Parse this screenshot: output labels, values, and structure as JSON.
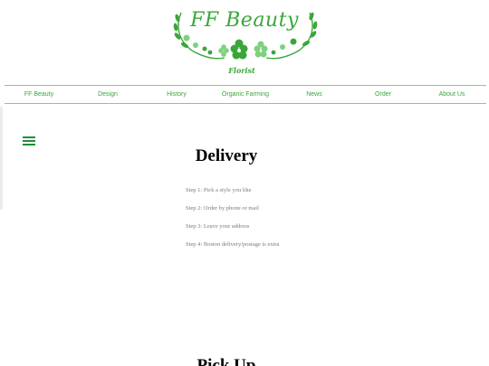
{
  "logo": {
    "title": "FF Beauty",
    "subtitle": "Florist"
  },
  "nav": {
    "items": [
      "FF Beauty",
      "Design",
      "History",
      "Organic Farming",
      "News",
      "Order",
      "About Us"
    ]
  },
  "delivery": {
    "title": "Delivery",
    "steps": [
      "Step 1: Pick a style you like",
      "Step 2: Order by phone or mail",
      "Step 3: Leave your address",
      "Step 4: Boston delivery/postage is extra"
    ]
  },
  "pickup": {
    "title": "Pick Up"
  },
  "colors": {
    "brand_green": "#3aa63a",
    "menu_icon": "#1f8f3a",
    "nav_border": "#7fd07f"
  },
  "icons": {
    "menu": "hamburger-menu-icon",
    "logo_decoration": "flower-wreath-icon"
  }
}
